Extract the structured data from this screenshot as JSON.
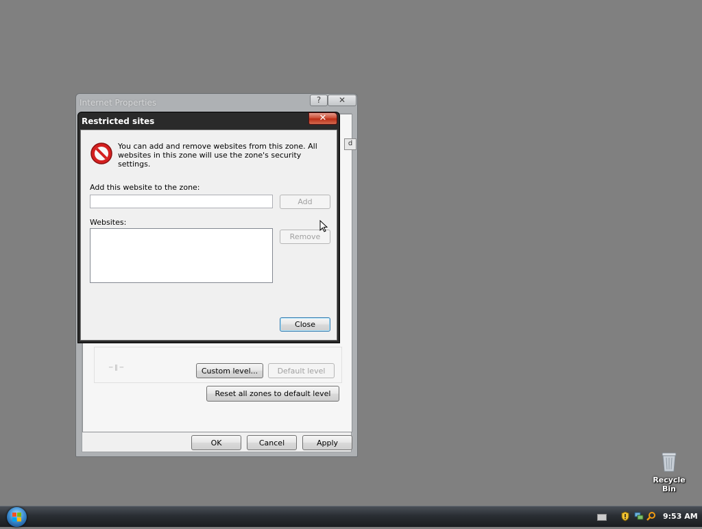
{
  "internet_properties": {
    "title": "Internet Properties",
    "help_glyph": "?",
    "close_glyph": "✕",
    "tab_corner_glyph": "d",
    "custom_level_label": "Custom level...",
    "default_level_label": "Default level",
    "reset_all_label": "Reset all zones to default level",
    "ok_label": "OK",
    "cancel_label": "Cancel",
    "apply_label": "Apply"
  },
  "restricted_sites": {
    "title": "Restricted sites",
    "close_glyph": "✕",
    "message": "You can add and remove websites from this zone. All websites in this zone will use the zone's security settings.",
    "add_label": "Add this website to the zone:",
    "add_input_value": "",
    "add_button_label": "Add",
    "websites_label": "Websites:",
    "websites": [],
    "remove_button_label": "Remove",
    "close_button_label": "Close"
  },
  "desktop": {
    "recycle_bin_label": "Recycle Bin"
  },
  "taskbar": {
    "clock": "9:53 AM"
  },
  "colors": {
    "desktop_bg": "#808080",
    "restricted_icon_red": "#d42020",
    "close_button_red": "#c8452c"
  }
}
